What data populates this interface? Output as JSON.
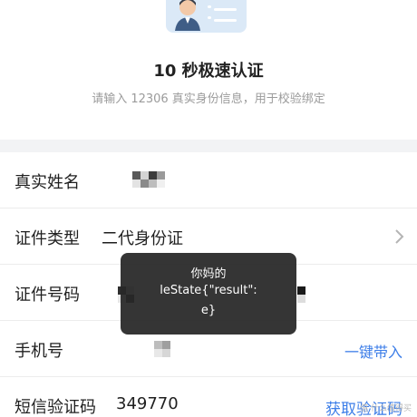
{
  "header": {
    "title": "10 秒极速认证",
    "subtitle": "请输入 12306 真实身份信息，用于校验绑定",
    "illustration_icon": "id-card-icon"
  },
  "form": {
    "name": {
      "label": "真实姓名",
      "value_redacted": true
    },
    "id_type": {
      "label": "证件类型",
      "value": "二代身份证",
      "chevron_icon": "chevron-right-icon"
    },
    "id_number": {
      "label": "证件号码",
      "value_redacted": true
    },
    "phone": {
      "label": "手机号",
      "value_redacted": true,
      "action": "一键带入"
    },
    "sms_code": {
      "label": "短信验证码",
      "value": "349770",
      "action": "获取验证码"
    }
  },
  "toast": {
    "line1": "你妈的",
    "line2": "leState{\"result\":",
    "line3": "e}"
  },
  "watermark": "值 什么值得买",
  "colors": {
    "link": "#3d7ee8",
    "toast_bg": "#282828",
    "divider_bg": "#f2f3f5"
  }
}
